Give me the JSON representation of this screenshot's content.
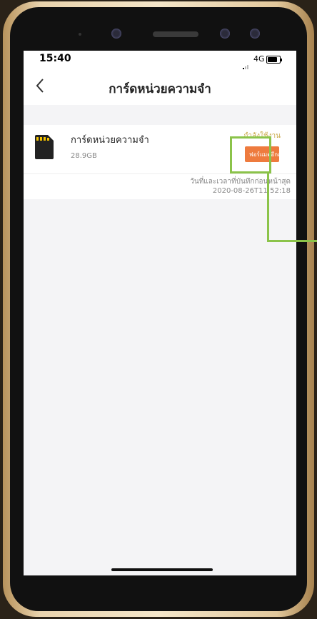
{
  "status_bar": {
    "time": "15:40",
    "network": "4G"
  },
  "nav": {
    "title": "การ์ดหน่วยความจำ",
    "back_icon": "chevron-left-icon"
  },
  "storage_card": {
    "name": "การ์ดหน่วยความจำ",
    "capacity": "28.9GB",
    "status": "กำลังใช้งาน",
    "format_button_label": "ฟอร์แมตอีกครั้ง",
    "icon": "sd-card-icon"
  },
  "last_record": {
    "label": "วันที่และเวลาที่บันทึกก่อนหน้าสุด",
    "value": "2020-08-26T11:52:18"
  },
  "colors": {
    "format_button": "#ee7b3e",
    "highlight": "#8bc34a",
    "status_text": "#c9a94a"
  }
}
